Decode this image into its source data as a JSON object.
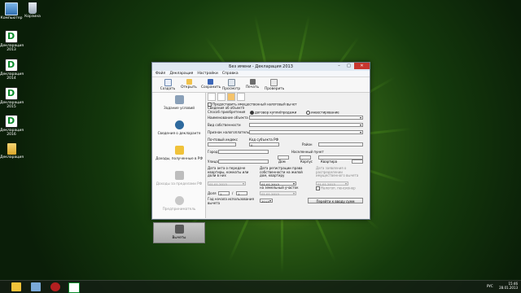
{
  "desktop": {
    "icons": [
      {
        "label": "Компьютер",
        "icon": "computer-icon"
      },
      {
        "label": "Корзина",
        "icon": "recycle-bin-icon"
      },
      {
        "label": "Декларация 2013",
        "icon": "declaration-app-icon"
      },
      {
        "label": "Декларация 2014",
        "icon": "declaration-app-icon"
      },
      {
        "label": "Декларация 2015",
        "icon": "declaration-app-icon"
      },
      {
        "label": "Декларация 2016",
        "icon": "declaration-app-icon"
      },
      {
        "label": "Декларация",
        "icon": "folder-icon"
      }
    ]
  },
  "window": {
    "title": "Без имени - Декларация 2013",
    "controls": {
      "minimize": "–",
      "maximize": "□",
      "close": "✕"
    },
    "menu": [
      "Файл",
      "Декларация",
      "Настройки",
      "Справка"
    ],
    "toolbar": [
      {
        "label": "Создать",
        "icon": "new-doc-icon"
      },
      {
        "label": "Открыть",
        "icon": "open-folder-icon"
      },
      {
        "label": "Сохранить",
        "icon": "save-icon"
      },
      {
        "label": "Просмотр",
        "icon": "preview-icon"
      },
      {
        "label": "Печать",
        "icon": "print-icon"
      },
      {
        "label": "Проверить",
        "icon": "check-icon"
      }
    ],
    "sidebar": [
      {
        "label": "Задание условий",
        "icon": "settings-icon"
      },
      {
        "label": "Сведения о декларанте",
        "icon": "person-icon"
      },
      {
        "label": "Доходы, полученные в РФ",
        "icon": "money-folder-icon"
      },
      {
        "label": "Доходы за пределами РФ",
        "icon": "foreign-income-icon"
      },
      {
        "label": "Предприниматель",
        "icon": "entrepreneur-icon"
      },
      {
        "label": "Вычеты",
        "icon": "deductions-icon"
      }
    ],
    "form": {
      "checkbox_label": "Предоставить имущественный налоговый вычет",
      "section": "Сведения об объекте",
      "acquisition_label": "Способ приобретения",
      "radio_contract": "договор купли/продажи",
      "radio_investment": "инвестирование",
      "object_name_label": "Наименование объекта",
      "ownership_label": "Вид собственности",
      "taxpayer_label": "Признак налогоплательщика",
      "postcode_label": "Почтовый индекс",
      "region_code_label": "Код субъекта РФ",
      "region_code_value": "0",
      "district_label": "Район",
      "city_label": "Город",
      "settlement_label": "Населенный пункт",
      "street_label": "Улица",
      "house_label": "Дом",
      "building_label": "Корпус",
      "apartment_label": "Квартира",
      "transfer_date_label": "Дата акта о передаче квартиры, комнаты или доли в них",
      "transfer_date_value": "01.01.2013",
      "registration_date_label": "Дата регистрации права собственности на жилой дом, квартиру",
      "registration_date_value": "01.01.2013",
      "application_date_label": "Дата заявления о распределении имущественного вычета",
      "application_date_value": "01.01.2013",
      "share_label": "Доля",
      "share_num": "1",
      "share_slash": "/",
      "share_den": "1",
      "land_label": "на земельный участок",
      "land_date_value": "01.01.2013",
      "pensioner_label": "Налогоп. пенсионер",
      "first_year_label": "Год начала использования вычета",
      "first_year_value": "2013",
      "next_button": "Перейти к вводу сумм"
    }
  },
  "taskbar": {
    "items": [
      "file-explorer-icon",
      "windows-explorer-icon",
      "media-player-icon",
      "declaration-app-icon"
    ],
    "lang": "РУС",
    "time": "15:46",
    "date": "28.01.2013"
  }
}
